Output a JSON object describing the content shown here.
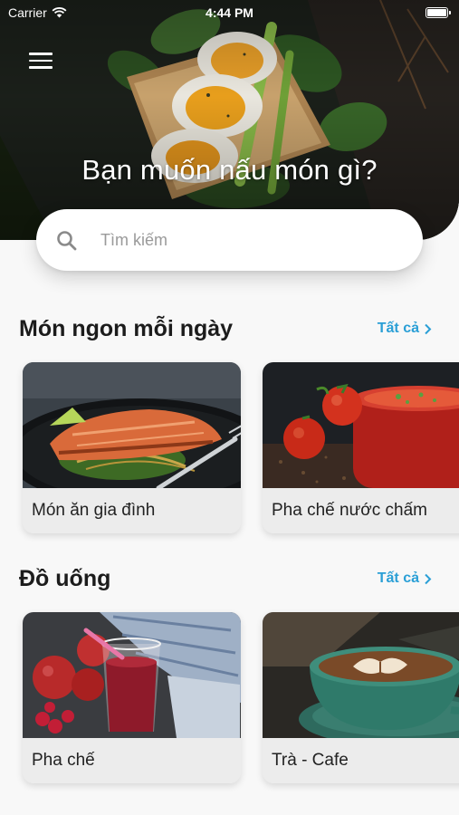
{
  "status_bar": {
    "carrier": "Carrier",
    "time": "4:44 PM"
  },
  "hero": {
    "title": "Bạn muốn nấu món gì?"
  },
  "search": {
    "placeholder": "Tìm kiếm"
  },
  "sections": [
    {
      "title": "Món ngon mỗi ngày",
      "see_all": "Tất cả",
      "cards": [
        {
          "label": "Món ăn gia đình"
        },
        {
          "label": "Pha chế nước chấm"
        }
      ]
    },
    {
      "title": "Đồ uống",
      "see_all": "Tất cả",
      "cards": [
        {
          "label": "Pha chế"
        },
        {
          "label": "Trà - Cafe"
        }
      ]
    }
  ],
  "colors": {
    "accent": "#2a9fd6",
    "background": "#f8f8f8",
    "card_label_bg": "#ececec"
  },
  "icons": {
    "menu": "hamburger-icon",
    "search": "search-icon",
    "chevron": "chevron-right-icon",
    "wifi": "wifi-icon",
    "battery": "battery-icon"
  }
}
